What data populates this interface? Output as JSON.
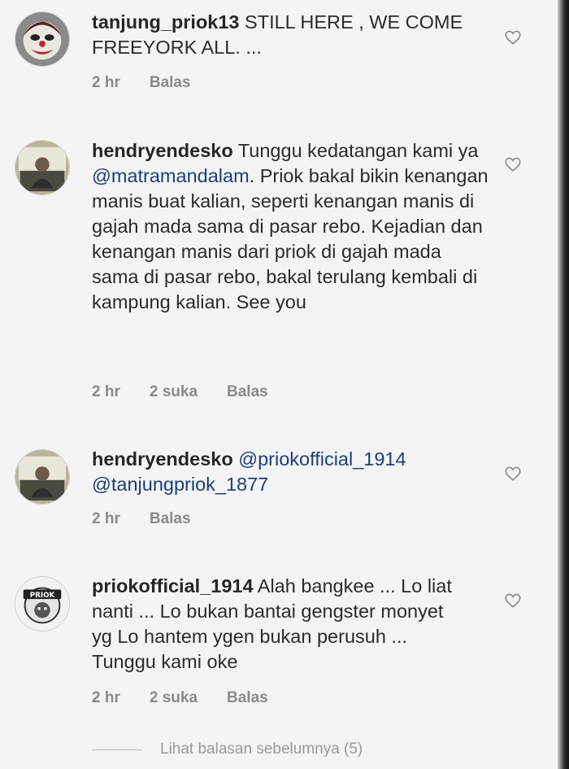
{
  "comments": [
    {
      "username": "tanjung_priok13",
      "text": "STILL HERE ,  WE COME FREEYORK ALL. ...",
      "time": "2 hr",
      "likes": "",
      "reply_label": "Balas",
      "avatar_icon": "clown-avatar-icon"
    },
    {
      "username": "hendryendesko",
      "text_before": "Tunggu kedatangan kami ya ",
      "mention": "@matramandalam",
      "text_after": ". Priok bakal bikin kenangan manis buat kalian, seperti kenangan manis di gajah mada sama di pasar rebo. Kejadian dan kenangan manis dari priok di gajah mada sama di pasar rebo, bakal terulang kembali di kampung kalian. See you",
      "time": "2 hr",
      "likes": "2 suka",
      "reply_label": "Balas",
      "avatar_icon": "person-photo-avatar-icon"
    },
    {
      "username": "hendryendesko",
      "mention1": "@priokofficial_1914",
      "mention2": "@tanjungpriok_1877",
      "time": "2 hr",
      "likes": "",
      "reply_label": "Balas",
      "avatar_icon": "person-photo-avatar-icon"
    },
    {
      "username": "priokofficial_1914",
      "text": "Alah bangkee ... Lo liat nanti ... Lo bukan bantai gengster monyet yg Lo hantem ygen bukan perusuh ... Tunggu kami oke",
      "time": "2 hr",
      "likes": "2 suka",
      "reply_label": "Balas",
      "avatar_icon": "priok-logo-avatar-icon",
      "logo_text": "PRIOK"
    }
  ],
  "view_previous_replies": "Lihat balasan sebelumnya (5)",
  "colors": {
    "background": "#f4f4f4",
    "mention": "#1b3f7a",
    "meta": "#8a8a8a"
  }
}
